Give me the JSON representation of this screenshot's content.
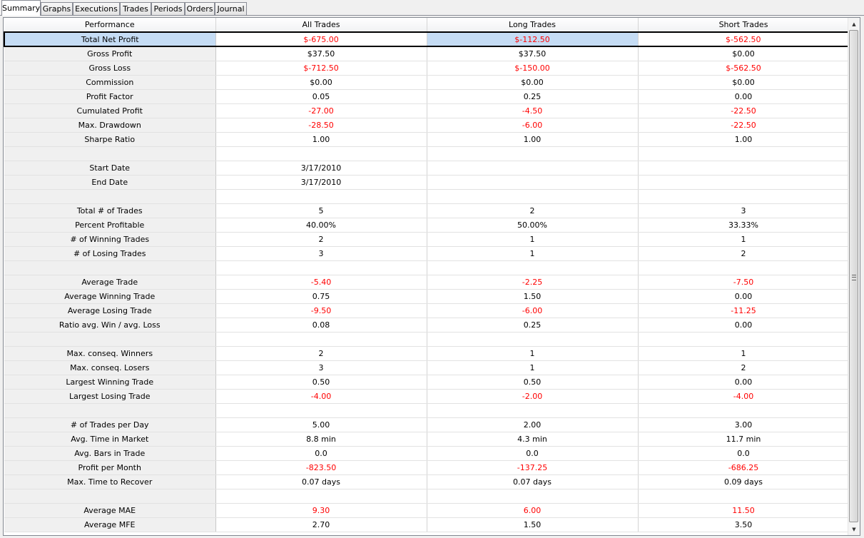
{
  "tabs": [
    {
      "label": "Summary",
      "active": true
    },
    {
      "label": "Graphs",
      "active": false
    },
    {
      "label": "Executions",
      "active": false
    },
    {
      "label": "Trades",
      "active": false
    },
    {
      "label": "Periods",
      "active": false
    },
    {
      "label": "Orders",
      "active": false
    },
    {
      "label": "Journal",
      "active": false
    }
  ],
  "table": {
    "columns": [
      "Performance",
      "All Trades",
      "Long Trades",
      "Short Trades"
    ],
    "selected_row": "Total Net Profit",
    "negative_color": "#ff0000",
    "rows": [
      {
        "label": "Total Net Profit",
        "values": [
          "$-675.00",
          "$-112.50",
          "$-562.50"
        ],
        "neg": [
          true,
          true,
          true
        ]
      },
      {
        "label": "Gross Profit",
        "values": [
          "$37.50",
          "$37.50",
          "$0.00"
        ],
        "neg": [
          false,
          false,
          false
        ]
      },
      {
        "label": "Gross Loss",
        "values": [
          "$-712.50",
          "$-150.00",
          "$-562.50"
        ],
        "neg": [
          true,
          true,
          true
        ]
      },
      {
        "label": "Commission",
        "values": [
          "$0.00",
          "$0.00",
          "$0.00"
        ],
        "neg": [
          false,
          false,
          false
        ]
      },
      {
        "label": "Profit Factor",
        "values": [
          "0.05",
          "0.25",
          "0.00"
        ],
        "neg": [
          false,
          false,
          false
        ]
      },
      {
        "label": "Cumulated Profit",
        "values": [
          "-27.00",
          "-4.50",
          "-22.50"
        ],
        "neg": [
          true,
          true,
          true
        ]
      },
      {
        "label": "Max. Drawdown",
        "values": [
          "-28.50",
          "-6.00",
          "-22.50"
        ],
        "neg": [
          true,
          true,
          true
        ]
      },
      {
        "label": "Sharpe Ratio",
        "values": [
          "1.00",
          "1.00",
          "1.00"
        ],
        "neg": [
          false,
          false,
          false
        ]
      },
      {
        "label": "",
        "values": [
          "",
          "",
          ""
        ],
        "neg": [
          false,
          false,
          false
        ]
      },
      {
        "label": "Start Date",
        "values": [
          "3/17/2010",
          "",
          ""
        ],
        "neg": [
          false,
          false,
          false
        ]
      },
      {
        "label": "End Date",
        "values": [
          "3/17/2010",
          "",
          ""
        ],
        "neg": [
          false,
          false,
          false
        ]
      },
      {
        "label": "",
        "values": [
          "",
          "",
          ""
        ],
        "neg": [
          false,
          false,
          false
        ]
      },
      {
        "label": "Total # of Trades",
        "values": [
          "5",
          "2",
          "3"
        ],
        "neg": [
          false,
          false,
          false
        ]
      },
      {
        "label": "Percent Profitable",
        "values": [
          "40.00%",
          "50.00%",
          "33.33%"
        ],
        "neg": [
          false,
          false,
          false
        ]
      },
      {
        "label": "# of Winning Trades",
        "values": [
          "2",
          "1",
          "1"
        ],
        "neg": [
          false,
          false,
          false
        ]
      },
      {
        "label": "# of Losing Trades",
        "values": [
          "3",
          "1",
          "2"
        ],
        "neg": [
          false,
          false,
          false
        ]
      },
      {
        "label": "",
        "values": [
          "",
          "",
          ""
        ],
        "neg": [
          false,
          false,
          false
        ]
      },
      {
        "label": "Average Trade",
        "values": [
          "-5.40",
          "-2.25",
          "-7.50"
        ],
        "neg": [
          true,
          true,
          true
        ]
      },
      {
        "label": "Average Winning Trade",
        "values": [
          "0.75",
          "1.50",
          "0.00"
        ],
        "neg": [
          false,
          false,
          false
        ]
      },
      {
        "label": "Average Losing Trade",
        "values": [
          "-9.50",
          "-6.00",
          "-11.25"
        ],
        "neg": [
          true,
          true,
          true
        ]
      },
      {
        "label": "Ratio avg. Win / avg. Loss",
        "values": [
          "0.08",
          "0.25",
          "0.00"
        ],
        "neg": [
          false,
          false,
          false
        ]
      },
      {
        "label": "",
        "values": [
          "",
          "",
          ""
        ],
        "neg": [
          false,
          false,
          false
        ]
      },
      {
        "label": "Max. conseq. Winners",
        "values": [
          "2",
          "1",
          "1"
        ],
        "neg": [
          false,
          false,
          false
        ]
      },
      {
        "label": "Max. conseq. Losers",
        "values": [
          "3",
          "1",
          "2"
        ],
        "neg": [
          false,
          false,
          false
        ]
      },
      {
        "label": "Largest Winning Trade",
        "values": [
          "0.50",
          "0.50",
          "0.00"
        ],
        "neg": [
          false,
          false,
          false
        ]
      },
      {
        "label": "Largest Losing Trade",
        "values": [
          "-4.00",
          "-2.00",
          "-4.00"
        ],
        "neg": [
          true,
          true,
          true
        ]
      },
      {
        "label": "",
        "values": [
          "",
          "",
          ""
        ],
        "neg": [
          false,
          false,
          false
        ]
      },
      {
        "label": "# of Trades per Day",
        "values": [
          "5.00",
          "2.00",
          "3.00"
        ],
        "neg": [
          false,
          false,
          false
        ]
      },
      {
        "label": "Avg. Time in Market",
        "values": [
          "8.8 min",
          "4.3 min",
          "11.7 min"
        ],
        "neg": [
          false,
          false,
          false
        ]
      },
      {
        "label": "Avg. Bars in Trade",
        "values": [
          "0.0",
          "0.0",
          "0.0"
        ],
        "neg": [
          false,
          false,
          false
        ]
      },
      {
        "label": "Profit per Month",
        "values": [
          "-823.50",
          "-137.25",
          "-686.25"
        ],
        "neg": [
          true,
          true,
          true
        ]
      },
      {
        "label": "Max. Time to Recover",
        "values": [
          "0.07 days",
          "0.07 days",
          "0.09 days"
        ],
        "neg": [
          false,
          false,
          false
        ]
      },
      {
        "label": "",
        "values": [
          "",
          "",
          ""
        ],
        "neg": [
          false,
          false,
          false
        ]
      },
      {
        "label": "Average MAE",
        "values": [
          "9.30",
          "6.00",
          "11.50"
        ],
        "neg": [
          true,
          true,
          true
        ]
      },
      {
        "label": "Average MFE",
        "values": [
          "2.70",
          "1.50",
          "3.50"
        ],
        "neg": [
          false,
          false,
          false
        ]
      }
    ]
  },
  "scrollbar": {
    "up_icon": "arrow-up-icon",
    "down_icon": "arrow-down-icon"
  }
}
